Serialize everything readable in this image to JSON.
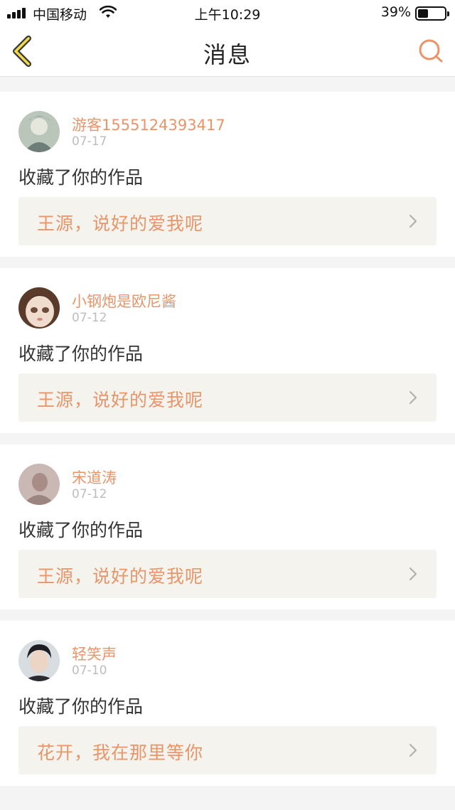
{
  "status_bar": {
    "carrier": "中国移动",
    "time": "上午10:29",
    "battery_percent": "39%",
    "battery_level": 0.39
  },
  "nav": {
    "title": "消息",
    "back_icon": "chevron-left-icon",
    "search_icon": "search-icon",
    "accent_color": "#e8956a"
  },
  "messages": [
    {
      "username": "游客1555124393417",
      "date": "07-17",
      "action": "收藏了你的作品",
      "work_title": "王源，说好的爱我呢"
    },
    {
      "username": "小钢炮是欧尼酱",
      "date": "07-12",
      "action": "收藏了你的作品",
      "work_title": "王源，说好的爱我呢"
    },
    {
      "username": "宋道涛",
      "date": "07-12",
      "action": "收藏了你的作品",
      "work_title": "王源，说好的爱我呢"
    },
    {
      "username": "轻笑声",
      "date": "07-10",
      "action": "收藏了你的作品",
      "work_title": "花开，我在那里等你"
    }
  ]
}
